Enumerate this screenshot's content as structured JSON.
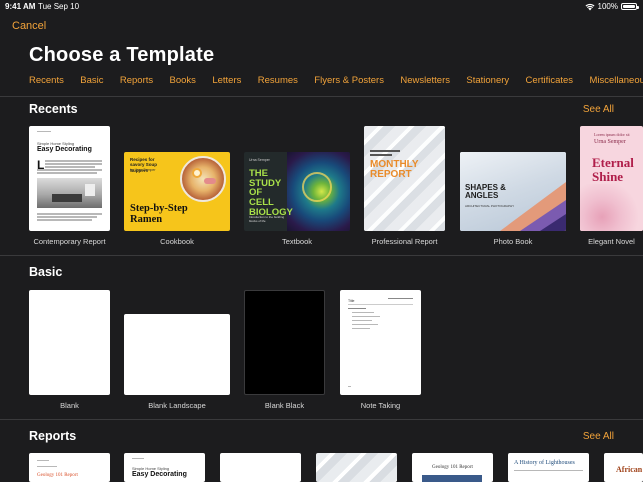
{
  "status_bar": {
    "time": "9:41 AM",
    "date": "Tue Sep 10",
    "battery": "100%"
  },
  "nav": {
    "cancel_label": "Cancel"
  },
  "page": {
    "title": "Choose a Template"
  },
  "categories": [
    "Recents",
    "Basic",
    "Reports",
    "Books",
    "Letters",
    "Resumes",
    "Flyers & Posters",
    "Newsletters",
    "Stationery",
    "Certificates",
    "Miscellaneous"
  ],
  "sections": {
    "recents": {
      "title": "Recents",
      "see_all": "See All"
    },
    "basic": {
      "title": "Basic"
    },
    "reports": {
      "title": "Reports",
      "see_all": "See All"
    }
  },
  "recents": [
    {
      "caption": "Contemporary Report",
      "thumb_title_small": "Simple Home Styling",
      "thumb_title": "Easy Decorating"
    },
    {
      "caption": "Cookbook",
      "thumb_sub": "Recipes for savory Soup Suppers",
      "thumb_by": "by Urna Semper",
      "thumb_title": "Step-by-Step Ramen"
    },
    {
      "caption": "Textbook",
      "thumb_author": "Urna Semper",
      "thumb_title": "THE STUDY OF CELL BIOLOGY",
      "thumb_sub": "Introduction to the building blocks of life"
    },
    {
      "caption": "Professional Report",
      "thumb_title": "MONTHLY REPORT"
    },
    {
      "caption": "Photo Book",
      "thumb_title": "SHAPES & ANGLES",
      "thumb_sub": "ARCHITECTURAL PHOTOGRAPHY"
    },
    {
      "caption": "Elegant Novel",
      "thumb_author": "Urna Semper",
      "thumb_title": "Eternal Shine"
    }
  ],
  "basic": [
    {
      "caption": "Blank"
    },
    {
      "caption": "Blank Landscape"
    },
    {
      "caption": "Blank Black"
    },
    {
      "caption": "Note Taking",
      "thumb_title": "Title"
    }
  ],
  "reports": [
    {
      "thumb_title": "Geology 101 Report"
    },
    {
      "thumb_title_small": "Simple Home Styling",
      "thumb_title": "Easy Decorating"
    },
    {
      "thumb_title": ""
    },
    {
      "thumb_title": ""
    },
    {
      "thumb_title": "Geology 101 Report"
    },
    {
      "thumb_title": "A History of Lighthouses"
    },
    {
      "thumb_title": "African"
    }
  ],
  "colors": {
    "accent": "#f2a33a",
    "background": "#1c1c1e",
    "divider": "#3a3a3c"
  }
}
